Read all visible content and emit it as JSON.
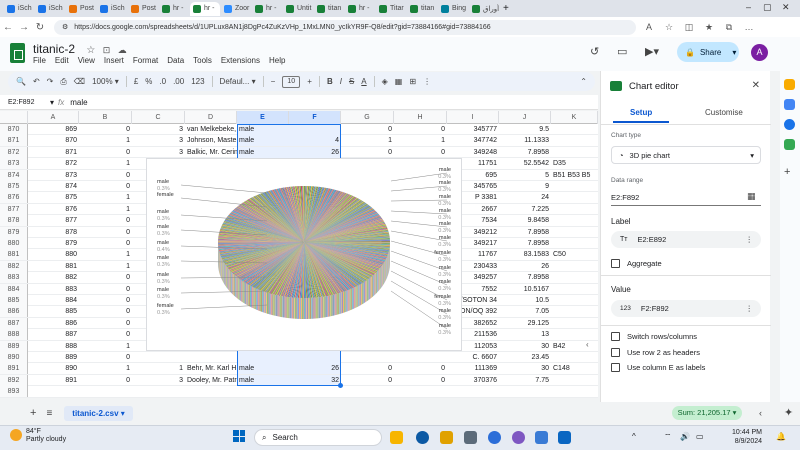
{
  "browser": {
    "tabs": [
      "iSch",
      "iSch",
      "Post",
      "iSch",
      "Post",
      "hr -",
      "hr -",
      "Zoor",
      "hr -",
      "Untit",
      "titan",
      "hr -",
      "Titar",
      "titan",
      "Bing",
      "أوراق"
    ],
    "url": "https://docs.google.com/spreadsheets/d/1UPLux8AN1j8DgPc4ZuKzVHp_1MxLMN0_ycIkYR9F-Q8/edit?gid=73884166#gid=73884166"
  },
  "app": {
    "title": "titanic-2",
    "menu": [
      "File",
      "Edit",
      "View",
      "Insert",
      "Format",
      "Data",
      "Tools",
      "Extensions",
      "Help"
    ],
    "share_label": "Share",
    "avatar_letter": "A"
  },
  "toolbar": {
    "zoom": "100%",
    "currency": "£",
    "percent": "%",
    "dec_dec": ".0",
    "dec_inc": ".00",
    "numfmt": "123",
    "font": "Defaul...",
    "font_size": "10",
    "bold": "B",
    "italic": "I"
  },
  "formula_bar": {
    "name_box": "E2:F892",
    "fx": "fx",
    "value": "male"
  },
  "grid": {
    "columns": [
      "A",
      "B",
      "C",
      "D",
      "E",
      "F",
      "G",
      "H",
      "I",
      "J",
      "K"
    ],
    "rows": [
      {
        "n": "870",
        "A": "869",
        "B": "0",
        "C": "3",
        "D": "van Melkebeke,",
        "E": "male",
        "F": "",
        "G": "0",
        "H": "0",
        "I": "345777",
        "J": "9.5",
        "K": ""
      },
      {
        "n": "871",
        "A": "870",
        "B": "1",
        "C": "3",
        "D": "Johnson, Maste",
        "E": "male",
        "F": "4",
        "G": "1",
        "H": "1",
        "I": "347742",
        "J": "11.1333",
        "K": ""
      },
      {
        "n": "872",
        "A": "871",
        "B": "0",
        "C": "3",
        "D": "Balkic, Mr. Cerin",
        "E": "male",
        "F": "26",
        "G": "0",
        "H": "0",
        "I": "349248",
        "J": "7.8958",
        "K": ""
      },
      {
        "n": "873",
        "A": "872",
        "B": "1",
        "C": "",
        "D": "",
        "E": "",
        "F": "",
        "G": "",
        "H": "",
        "I": "11751",
        "J": "52.5542",
        "K": "D35"
      },
      {
        "n": "874",
        "A": "873",
        "B": "0",
        "C": "",
        "D": "",
        "E": "",
        "F": "",
        "G": "",
        "H": "",
        "I": "695",
        "J": "5",
        "K": "B51 B53 B5"
      },
      {
        "n": "875",
        "A": "874",
        "B": "0",
        "C": "",
        "D": "",
        "E": "",
        "F": "",
        "G": "",
        "H": "",
        "I": "345765",
        "J": "9",
        "K": ""
      },
      {
        "n": "876",
        "A": "875",
        "B": "1",
        "C": "",
        "D": "",
        "E": "",
        "F": "",
        "G": "",
        "H": "",
        "I": "P 3381",
        "J": "24",
        "K": ""
      },
      {
        "n": "877",
        "A": "876",
        "B": "1",
        "C": "",
        "D": "",
        "E": "",
        "F": "",
        "G": "",
        "H": "",
        "I": "2667",
        "J": "7.225",
        "K": ""
      },
      {
        "n": "878",
        "A": "877",
        "B": "0",
        "C": "",
        "D": "",
        "E": "",
        "F": "",
        "G": "",
        "H": "",
        "I": "7534",
        "J": "9.8458",
        "K": ""
      },
      {
        "n": "879",
        "A": "878",
        "B": "0",
        "C": "",
        "D": "",
        "E": "",
        "F": "",
        "G": "",
        "H": "",
        "I": "349212",
        "J": "7.8958",
        "K": ""
      },
      {
        "n": "880",
        "A": "879",
        "B": "0",
        "C": "",
        "D": "",
        "E": "",
        "F": "",
        "G": "",
        "H": "",
        "I": "349217",
        "J": "7.8958",
        "K": ""
      },
      {
        "n": "881",
        "A": "880",
        "B": "1",
        "C": "",
        "D": "",
        "E": "",
        "F": "",
        "G": "",
        "H": "",
        "I": "11767",
        "J": "83.1583",
        "K": "C50"
      },
      {
        "n": "882",
        "A": "881",
        "B": "1",
        "C": "",
        "D": "",
        "E": "",
        "F": "",
        "G": "",
        "H": "",
        "I": "230433",
        "J": "26",
        "K": ""
      },
      {
        "n": "883",
        "A": "882",
        "B": "0",
        "C": "",
        "D": "",
        "E": "",
        "F": "",
        "G": "",
        "H": "",
        "I": "349257",
        "J": "7.8958",
        "K": ""
      },
      {
        "n": "884",
        "A": "883",
        "B": "0",
        "C": "",
        "D": "",
        "E": "",
        "F": "",
        "G": "",
        "H": "",
        "I": "7552",
        "J": "10.5167",
        "K": ""
      },
      {
        "n": "885",
        "A": "884",
        "B": "0",
        "C": "",
        "D": "",
        "E": "",
        "F": "",
        "G": "",
        "H": "",
        "I": "/SOTON 34",
        "J": "10.5",
        "K": ""
      },
      {
        "n": "886",
        "A": "885",
        "B": "0",
        "C": "",
        "D": "",
        "E": "",
        "F": "",
        "G": "",
        "H": "",
        "I": "TON/OQ 392",
        "J": "7.05",
        "K": ""
      },
      {
        "n": "887",
        "A": "886",
        "B": "0",
        "C": "",
        "D": "",
        "E": "",
        "F": "",
        "G": "",
        "H": "",
        "I": "382652",
        "J": "29.125",
        "K": ""
      },
      {
        "n": "888",
        "A": "887",
        "B": "0",
        "C": "",
        "D": "",
        "E": "",
        "F": "",
        "G": "",
        "H": "",
        "I": "211536",
        "J": "13",
        "K": ""
      },
      {
        "n": "889",
        "A": "888",
        "B": "1",
        "C": "",
        "D": "",
        "E": "",
        "F": "",
        "G": "",
        "H": "",
        "I": "112053",
        "J": "30",
        "K": "B42"
      },
      {
        "n": "890",
        "A": "889",
        "B": "0",
        "C": "",
        "D": "",
        "E": "",
        "F": "",
        "G": "",
        "H": "",
        "I": "C. 6607",
        "J": "23.45",
        "K": ""
      },
      {
        "n": "891",
        "A": "890",
        "B": "1",
        "C": "1",
        "D": "Behr, Mr. Karl H",
        "E": "male",
        "F": "26",
        "G": "0",
        "H": "0",
        "I": "111369",
        "J": "30",
        "K": "C148"
      },
      {
        "n": "892",
        "A": "891",
        "B": "0",
        "C": "3",
        "D": "Dooley, Mr. Patr",
        "E": "male",
        "F": "32",
        "G": "0",
        "H": "0",
        "I": "370376",
        "J": "7.75",
        "K": ""
      },
      {
        "n": "893",
        "A": "",
        "B": "",
        "C": "",
        "D": "",
        "E": "",
        "F": "",
        "G": "",
        "H": "",
        "I": "",
        "J": "",
        "K": ""
      },
      {
        "n": "894",
        "A": "",
        "B": "",
        "C": "",
        "D": "",
        "E": "",
        "F": "",
        "G": "",
        "H": "",
        "I": "",
        "J": "",
        "K": ""
      }
    ]
  },
  "chart_data": {
    "type": "pie",
    "variant": "3D",
    "title": "",
    "legend_left": [
      {
        "label": "male",
        "pct": "0.3%"
      },
      {
        "label": "female",
        "pct": ""
      },
      {
        "label": "male",
        "pct": "0.3%"
      },
      {
        "label": "male",
        "pct": "0.3%"
      },
      {
        "label": "male",
        "pct": "0.4%"
      },
      {
        "label": "male",
        "pct": "0.3%"
      },
      {
        "label": "male",
        "pct": "0.3%"
      },
      {
        "label": "male",
        "pct": "0.3%"
      },
      {
        "label": "female",
        "pct": "0.3%"
      }
    ],
    "legend_right": [
      {
        "label": "male",
        "pct": "0.3%"
      },
      {
        "label": "male",
        "pct": "0.3%"
      },
      {
        "label": "male",
        "pct": "0.3%"
      },
      {
        "label": "male",
        "pct": "0.3%"
      },
      {
        "label": "male",
        "pct": "0.3%"
      },
      {
        "label": "male",
        "pct": "0.3%"
      },
      {
        "label": "female",
        "pct": "0.3%"
      },
      {
        "label": "male",
        "pct": "0.3%"
      },
      {
        "label": "male",
        "pct": "0.3%"
      },
      {
        "label": "female",
        "pct": "0.3%"
      },
      {
        "label": "male",
        "pct": "0.3%"
      },
      {
        "label": "male",
        "pct": "0.3%"
      }
    ]
  },
  "sheet_tab": "titanic-2.csv",
  "sum_chip": "Sum: 21,205.17",
  "editor": {
    "title": "Chart editor",
    "tab_setup": "Setup",
    "tab_customise": "Customise",
    "chart_type_label": "Chart type",
    "chart_type_value": "3D pie chart",
    "data_range_label": "Data range",
    "data_range_value": "E2:F892",
    "label_heading": "Label",
    "label_value": "E2:E892",
    "aggregate": "Aggregate",
    "value_heading": "Value",
    "value_value": "F2:F892",
    "opt_switch": "Switch rows/columns",
    "opt_headers": "Use row 2 as headers",
    "opt_labels": "Use column E as labels"
  },
  "taskbar": {
    "temp": "84°F",
    "weather": "Partly cloudy",
    "search": "Search",
    "time": "10:44 PM",
    "date": "8/9/2024"
  }
}
